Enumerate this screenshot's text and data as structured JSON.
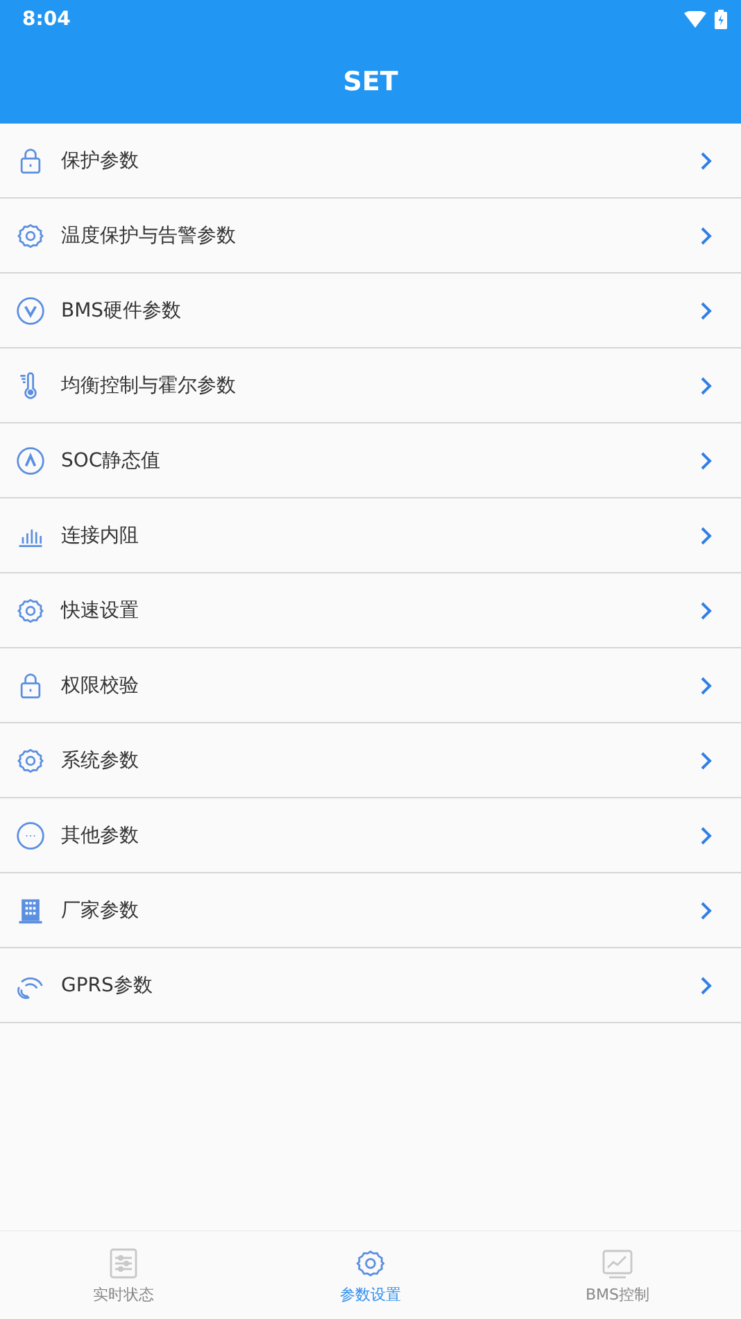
{
  "status_bar": {
    "time": "8:04"
  },
  "header": {
    "title": "SET"
  },
  "menu": [
    {
      "label": "保护参数"
    },
    {
      "label": "温度保护与告警参数"
    },
    {
      "label": "BMS硬件参数"
    },
    {
      "label": "均衡控制与霍尔参数"
    },
    {
      "label": "SOC静态值"
    },
    {
      "label": "连接内阻"
    },
    {
      "label": "快速设置"
    },
    {
      "label": "权限校验"
    },
    {
      "label": "系统参数"
    },
    {
      "label": "其他参数"
    },
    {
      "label": "厂家参数"
    },
    {
      "label": "GPRS参数"
    }
  ],
  "bottom_nav": [
    {
      "label": "实时状态",
      "selected": false
    },
    {
      "label": "参数设置",
      "selected": true
    },
    {
      "label": "BMS控制",
      "selected": false
    }
  ]
}
